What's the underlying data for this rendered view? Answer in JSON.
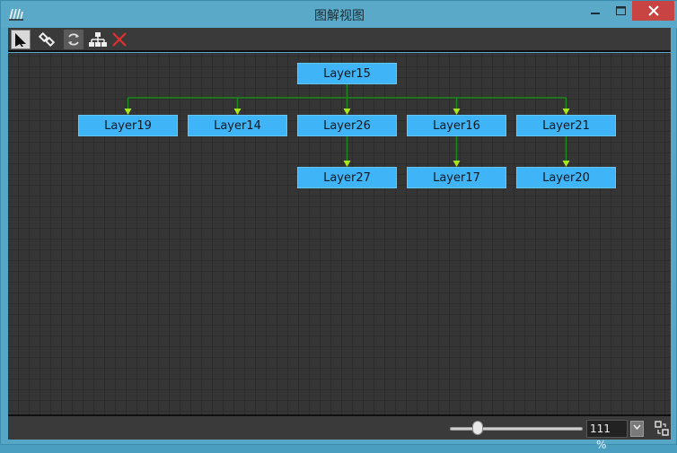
{
  "window": {
    "title": "图解视图",
    "min_icon": "minimize-icon",
    "max_icon": "maximize-icon",
    "close_icon": "close-icon"
  },
  "toolbar": {
    "tools": [
      "select-arrow-icon",
      "link-icon",
      "refresh-icon",
      "hierarchy-icon",
      "delete-x-icon"
    ]
  },
  "graph": {
    "root": "Layer15",
    "children": [
      {
        "label": "Layer19",
        "children": []
      },
      {
        "label": "Layer14",
        "children": []
      },
      {
        "label": "Layer26",
        "children": [
          "Layer27"
        ]
      },
      {
        "label": "Layer16",
        "children": [
          "Layer17"
        ]
      },
      {
        "label": "Layer21",
        "children": [
          "Layer20"
        ]
      }
    ],
    "colors": {
      "node": "#3fb4f7",
      "edge": "#1a8a1a",
      "arrow": "#a8e81a"
    }
  },
  "statusbar": {
    "zoom_value": "111",
    "zoom_unit": "%",
    "dropdown_icon": "chevron-down-icon",
    "fit_icon": "fit-view-icon"
  }
}
